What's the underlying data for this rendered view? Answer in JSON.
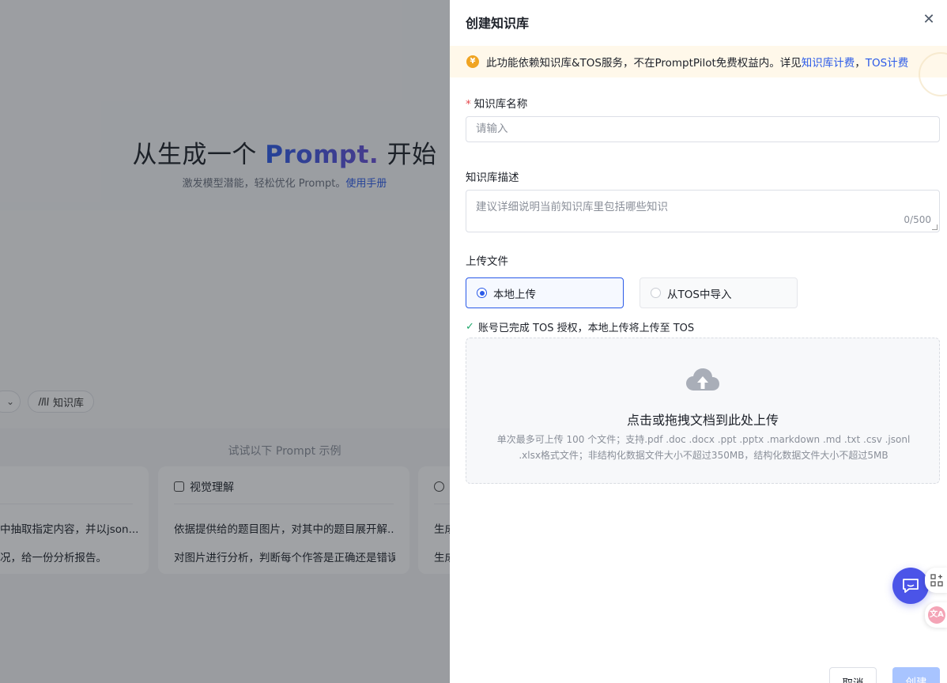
{
  "background": {
    "hero_title_pre": "从生成一个 ",
    "hero_title_accent": "Prompt.",
    "hero_title_post": " 开始",
    "hero_sub": "激发模型潜能，轻松优化 Prompt。",
    "hero_sub_link": "使用手册",
    "chip_kb": "知识库",
    "examples_label": "试试以下 Prompt 示例",
    "cards": [
      {
        "title": "",
        "line1": "中抽取指定内容，并以json...",
        "line2": "况，给一份分析报告。"
      },
      {
        "title": "视觉理解",
        "line1": "依据提供给的题目图片，对其中的题目展开解...",
        "line2": "对图片进行分析，判断每个作答是正确还是错误"
      },
      {
        "title": "",
        "line1": "生成",
        "line2": "生成"
      }
    ]
  },
  "drawer": {
    "title": "创建知识库",
    "notice": {
      "text": "此功能依赖知识库&TOS服务，不在PromptPilot免费权益内。详见",
      "link1": "知识库计费",
      "sep": "，",
      "link2": "TOS计费",
      "icon_label": "¥"
    },
    "name_field": {
      "required_mark": "*",
      "label": "知识库名称",
      "placeholder": "请输入"
    },
    "desc_field": {
      "label": "知识库描述",
      "placeholder": "建议详细说明当前知识库里包括哪些知识",
      "counter": "0/500"
    },
    "upload": {
      "label": "上传文件",
      "options": [
        {
          "label": "本地上传",
          "selected": true
        },
        {
          "label": "从TOS中导入",
          "selected": false
        }
      ],
      "auth_ok": "账号已完成 TOS 授权，本地上传将上传至 TOS",
      "dropzone_title": "点击或拖拽文档到此处上传",
      "dropzone_desc": "单次最多可上传 100 个文件；支持.pdf .doc .docx .ppt .pptx .markdown .md .txt .csv .jsonl .xlsx格式文件；非结构化数据文件大小不超过350MB，结构化数据文件大小不超过5MB"
    },
    "buttons": {
      "cancel": "取消",
      "create": "创建"
    }
  },
  "colors": {
    "accent": "#2a5ae8",
    "notice_bg": "#fff8ea",
    "create_disabled": "#a8c4ff",
    "chat_fab": "#4b54e8"
  },
  "icons": [
    "close-icon",
    "coin-icon",
    "check-icon",
    "cloud-upload-icon",
    "chat-icon",
    "grid-plus-icon",
    "translate-icon",
    "book-icon",
    "image-icon",
    "message-icon",
    "chevron-down-icon"
  ]
}
